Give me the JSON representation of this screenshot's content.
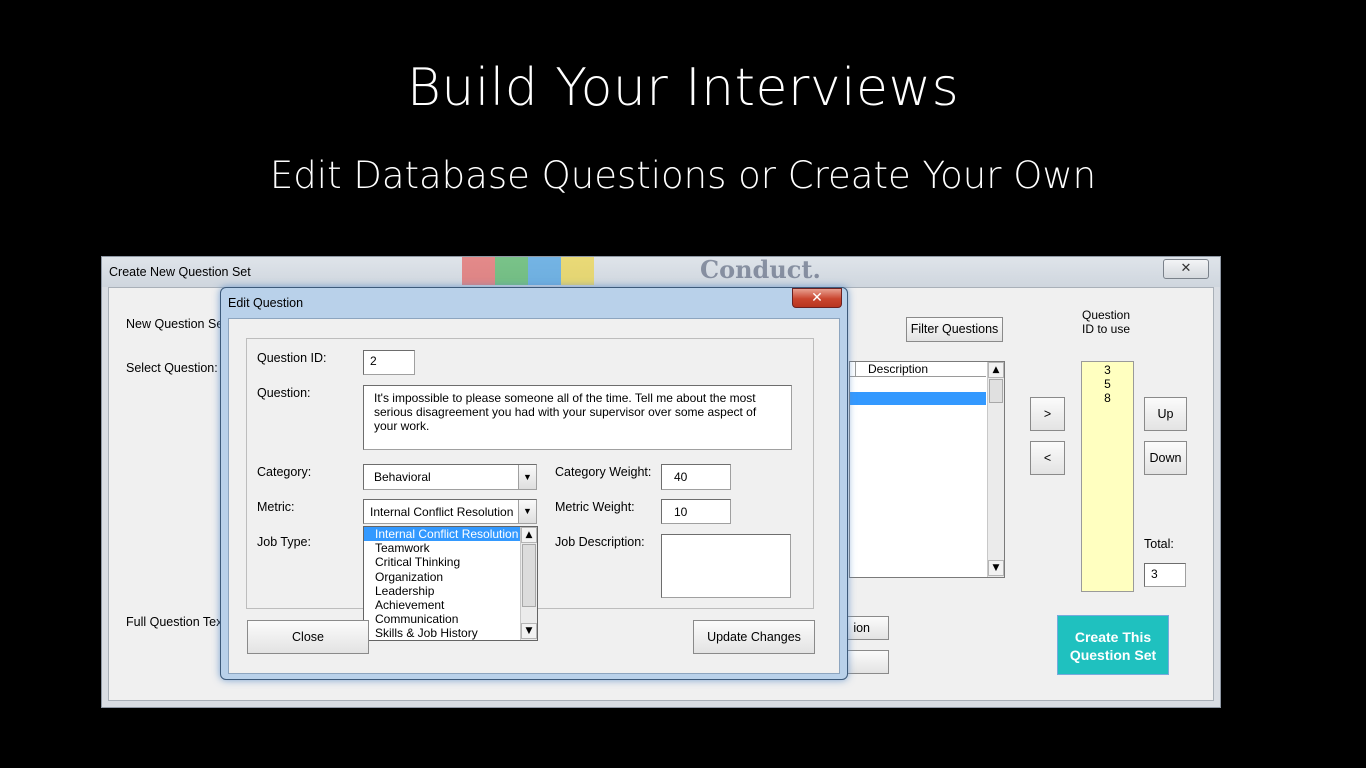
{
  "slide": {
    "title": "Build Your Interviews",
    "subtitle": "Edit Database Questions or Create Your Own"
  },
  "bg_window": {
    "title": "Create New Question Set",
    "close_glyph": "✕",
    "header_text": "Conduct.",
    "labels": {
      "new_question_set": "New Question Set",
      "select_question": "Select Question:",
      "full_question_text": "Full Question Text"
    },
    "filter_button": "Filter Questions",
    "list_column_description": "Description",
    "move_right": ">",
    "move_left": "<",
    "question_id_heading": "Question\nID to use",
    "question_ids": [
      "3",
      "5",
      "8"
    ],
    "up_button": "Up",
    "down_button": "Down",
    "total_label": "Total:",
    "total_value": "3",
    "hidden_button_fragment": "ion",
    "create_button": "Create This Question Set",
    "logo_colors": [
      "#e8413c",
      "#27a83a",
      "#1e8ee0",
      "#f3d21a"
    ]
  },
  "edit_dialog": {
    "title": "Edit Question",
    "close_glyph": "✕",
    "question_id_label": "Question ID:",
    "question_id_value": "2",
    "question_label": "Question:",
    "question_text": "It's impossible to please someone all of the time. Tell me about the most serious disagreement you had with your supervisor over some aspect of your work.",
    "category_label": "Category:",
    "category_value": "Behavioral",
    "category_weight_label": "Category Weight:",
    "category_weight_value": "40",
    "metric_label": "Metric:",
    "metric_value": "Internal Conflict Resolution",
    "metric_weight_label": "Metric Weight:",
    "metric_weight_value": "10",
    "job_type_label": "Job Type:",
    "job_description_label": "Job Description:",
    "metric_options": [
      "Internal Conflict Resolution",
      "Teamwork",
      "Critical Thinking",
      "Organization",
      "Leadership",
      "Achievement",
      "Communication",
      "Skills & Job History"
    ],
    "selected_option_index": 0,
    "close_button": "Close",
    "update_button": "Update Changes"
  }
}
